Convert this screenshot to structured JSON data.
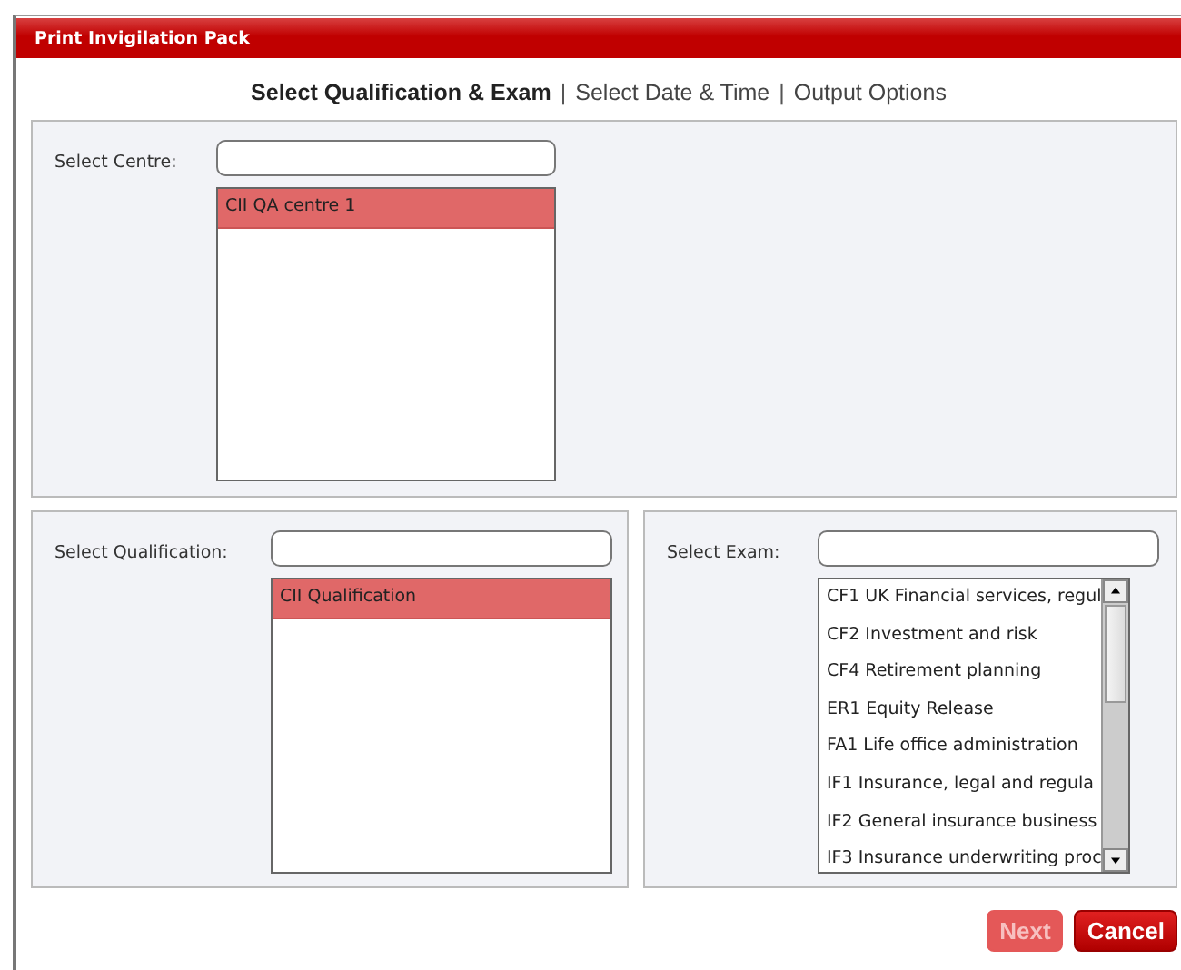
{
  "window": {
    "title": "Print Invigilation Pack"
  },
  "steps": [
    {
      "label": "Select Qualification & Exam",
      "selected": true
    },
    {
      "label": "Select Date & Time",
      "selected": false
    },
    {
      "label": "Output Options",
      "selected": false
    }
  ],
  "step_separators": [
    "|",
    "|"
  ],
  "centre": {
    "label": "Select Centre:",
    "items": [
      {
        "label": "CII QA centre 1",
        "selected": true
      }
    ]
  },
  "qualification": {
    "label": "Select Qualification:",
    "items": [
      {
        "label": "CII Qualification",
        "selected": true
      }
    ]
  },
  "exam": {
    "label": "Select Exam:",
    "items": [
      {
        "label": "CF1 UK Financial services, regul",
        "selected": false
      },
      {
        "label": "CF2 Investment and risk",
        "selected": false
      },
      {
        "label": "CF4 Retirement planning",
        "selected": false
      },
      {
        "label": "ER1 Equity Release",
        "selected": false
      },
      {
        "label": "FA1 Life office administration",
        "selected": false
      },
      {
        "label": "IF1 Insurance, legal and regula",
        "selected": false
      },
      {
        "label": "IF2 General insurance business",
        "selected": false
      },
      {
        "label": "IF3 Insurance underwriting proc",
        "selected": false
      }
    ]
  },
  "buttons": [
    {
      "label": "Next",
      "disabled": true
    },
    {
      "label": "Cancel",
      "disabled": false
    }
  ]
}
